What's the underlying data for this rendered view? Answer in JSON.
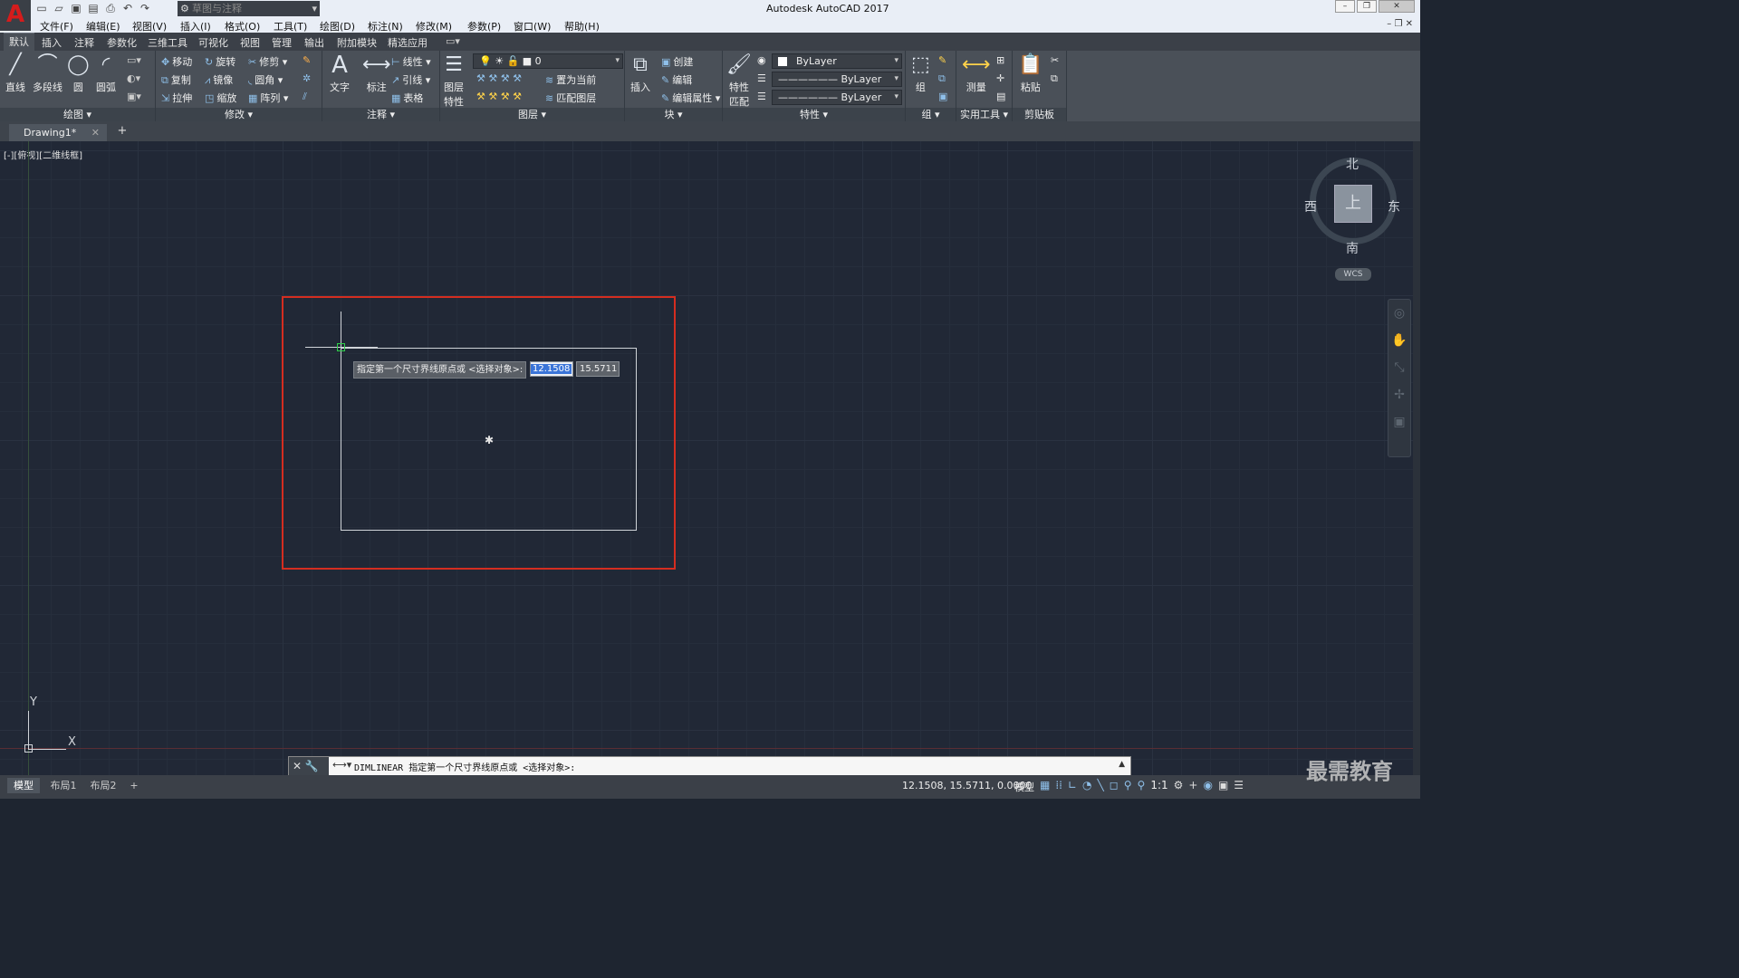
{
  "titlebar": {
    "app_title": "Autodesk AutoCAD 2017",
    "workspace": "草图与注释"
  },
  "menu": [
    "文件(F)",
    "编辑(E)",
    "视图(V)",
    "插入(I)",
    "格式(O)",
    "工具(T)",
    "绘图(D)",
    "标注(N)",
    "修改(M)",
    "参数(P)",
    "窗口(W)",
    "帮助(H)"
  ],
  "ribbon_tabs": [
    "默认",
    "插入",
    "注释",
    "参数化",
    "三维工具",
    "可视化",
    "视图",
    "管理",
    "输出",
    "附加模块",
    "精选应用"
  ],
  "draw": {
    "title": "绘图",
    "line": "直线",
    "polyline": "多段线",
    "circle": "圆",
    "arc": "圆弧"
  },
  "modify": {
    "title": "修改",
    "move": "移动",
    "rotate": "旋转",
    "trim": "修剪",
    "copy": "复制",
    "mirror": "镜像",
    "fillet": "圆角",
    "stretch": "拉伸",
    "scale": "缩放",
    "array": "阵列"
  },
  "annotation": {
    "title": "注释",
    "text": "文字",
    "dim": "标注",
    "linear": "线性",
    "leader": "引线",
    "table": "表格"
  },
  "layers": {
    "title": "图层",
    "props_line1": "图层",
    "props_line2": "特性",
    "current_layer": "0",
    "set_current": "置为当前",
    "match_layer": "匹配图层"
  },
  "block": {
    "title": "块",
    "insert": "插入",
    "create": "创建",
    "edit": "编辑",
    "edit_attr": "编辑属性"
  },
  "properties": {
    "title": "特性",
    "match_line1": "特性",
    "match_line2": "匹配",
    "color": "ByLayer",
    "linetype": "ByLayer",
    "lineweight": "ByLayer"
  },
  "groups": {
    "title": "组",
    "group": "组"
  },
  "utilities": {
    "title": "实用工具",
    "measure": "测量"
  },
  "clipboard": {
    "title": "剪贴板",
    "paste": "粘贴"
  },
  "doc_tab": "Drawing1*",
  "viewport_label": "[-][俯视][二维线框]",
  "viewcube": {
    "face": "上",
    "north": "北",
    "south": "南",
    "east": "东",
    "west": "西",
    "wcs": "WCS"
  },
  "dynamic_input": {
    "prompt": "指定第一个尺寸界线原点或 <选择对象>:",
    "x_value": "12.1508",
    "y_value": "15.5711"
  },
  "ucs": {
    "x": "X",
    "y": "Y"
  },
  "command_line": "DIMLINEAR 指定第一个尺寸界线原点或 <选择对象>:",
  "layout_tabs": [
    "模型",
    "布局1",
    "布局2"
  ],
  "status": {
    "coords": "12.1508, 15.5711, 0.0000",
    "model": "模型",
    "scale": "1:1"
  },
  "watermark": "最需教育",
  "colors": {
    "selection_box": "#d42d20",
    "pickbox": "#2fd04a",
    "logo": "#d51c1c"
  }
}
